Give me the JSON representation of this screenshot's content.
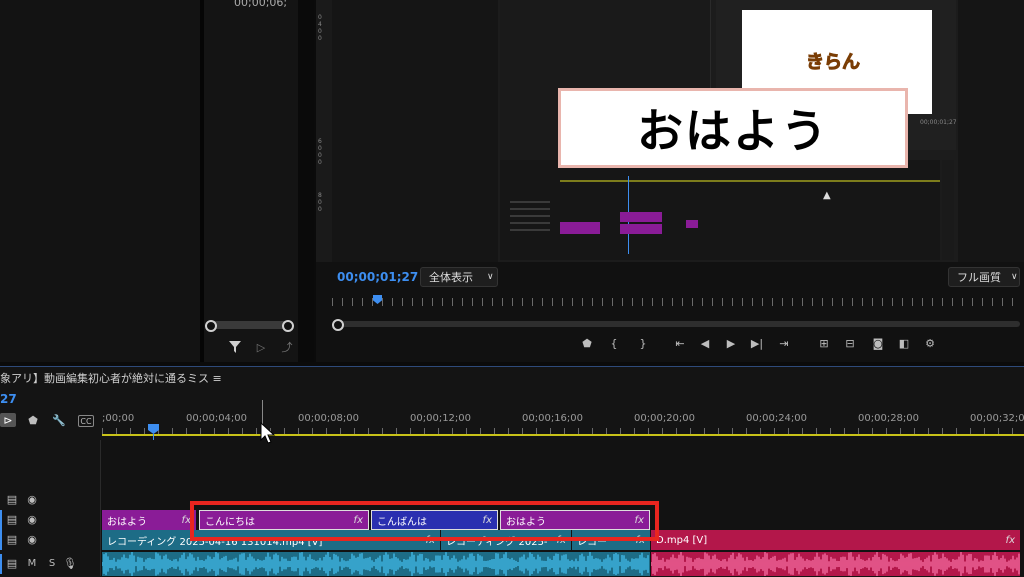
{
  "left_panel": {
    "timecode": "00;00;06;"
  },
  "program_monitor": {
    "timecode": "00;00;01;27",
    "zoom_select": "全体表示",
    "quality_select": "フル画質",
    "caption_text": "おはよう",
    "logo_text": "きらん",
    "inner_timecode": "00;00;01;27"
  },
  "timeline": {
    "title": "象アリ】動画編集初心者が絶対に通るミス ≡",
    "timecode": "27",
    "ruler_labels": [
      ";00;00",
      "00;00;04;00",
      "00;00;08;00",
      "00;00;12;00",
      "00;00;16;00",
      "00;00;20;00",
      "00;00;24;00",
      "00;00;28;00",
      "00;00;32;0"
    ],
    "track_v3_clips": [
      {
        "label": "おはよう",
        "fx": "fx"
      },
      {
        "label": "こんにちは",
        "fx": "fx"
      },
      {
        "label": "こんばんは",
        "fx": "fx"
      },
      {
        "label": "おはよう",
        "fx": "fx"
      }
    ],
    "track_v1_clips": [
      {
        "label": "レコーディング 2025-04-16 131014.mp4 [V]",
        "fx": "fx"
      },
      {
        "label": "レコーディング 2025-",
        "fx": "fx"
      },
      {
        "label": "レコー",
        "fx": "fx"
      },
      {
        "label": "D.mp4 [V]",
        "fx": "fx"
      }
    ],
    "audio_track_letters": {
      "m": "M",
      "s": "S"
    },
    "colors": {
      "purple_clip": "#8a1c97",
      "blue_clip": "#2a2fb0",
      "teal_clip": "#1d6c86",
      "pink_clip": "#b3174a",
      "audio_blue": "#3fb4e0",
      "audio_pink": "#f0679a",
      "highlight": "#e8251f",
      "playhead": "#3d8ef0"
    }
  }
}
